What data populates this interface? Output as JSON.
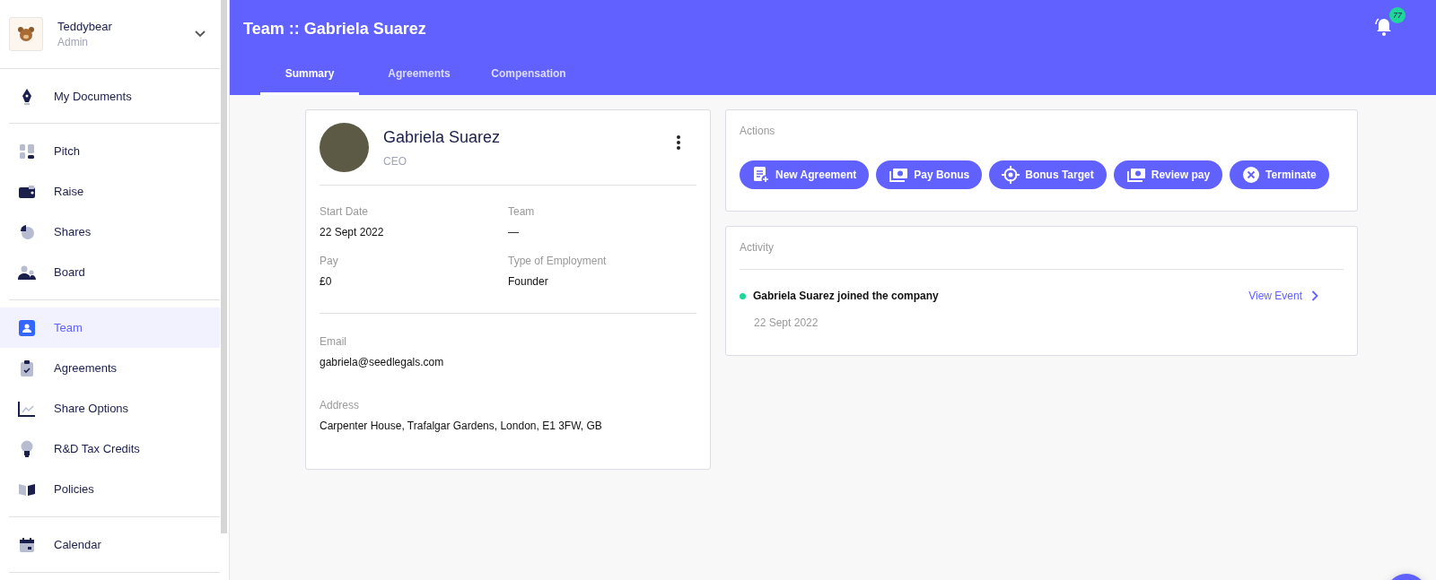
{
  "company": {
    "name": "Teddybear",
    "role": "Admin"
  },
  "sidebar": {
    "groups": [
      [
        {
          "label": "My Documents",
          "selected": false
        }
      ],
      [
        {
          "label": "Pitch",
          "selected": false
        },
        {
          "label": "Raise",
          "selected": false
        },
        {
          "label": "Shares",
          "selected": false
        },
        {
          "label": "Board",
          "selected": false
        }
      ],
      [
        {
          "label": "Team",
          "selected": true
        },
        {
          "label": "Agreements",
          "selected": false
        },
        {
          "label": "Share Options",
          "selected": false
        },
        {
          "label": "R&D Tax Credits",
          "selected": false
        },
        {
          "label": "Policies",
          "selected": false
        }
      ],
      [
        {
          "label": "Calendar",
          "selected": false
        }
      ]
    ]
  },
  "header": {
    "title": "Team :: Gabriela Suarez",
    "notifications": "77"
  },
  "tabs": [
    {
      "label": "Summary",
      "selected": true
    },
    {
      "label": "Agreements",
      "selected": false
    },
    {
      "label": "Compensation",
      "selected": false
    }
  ],
  "profile": {
    "name": "Gabriela Suarez",
    "role": "CEO",
    "fields": [
      {
        "label": "Start Date",
        "value": "22 Sept 2022"
      },
      {
        "label": "Team",
        "value": "—"
      },
      {
        "label": "Pay",
        "value": "£0"
      },
      {
        "label": "Type of Employment",
        "value": "Founder"
      }
    ],
    "contact": [
      {
        "label": "Email",
        "value": "gabriela@seedlegals.com"
      },
      {
        "label": "Address",
        "value": "Carpenter House, Trafalgar Gardens, London, E1 3FW, GB"
      }
    ]
  },
  "actions": {
    "title": "Actions",
    "buttons": [
      {
        "label": "New Agreement",
        "kind": "document"
      },
      {
        "label": "Pay Bonus",
        "kind": "money"
      },
      {
        "label": "Bonus Target",
        "kind": "target"
      },
      {
        "label": "Review pay",
        "kind": "money"
      },
      {
        "label": "Terminate",
        "kind": "cancel"
      }
    ]
  },
  "activity": {
    "title": "Activity",
    "events": [
      {
        "text": "Gabriela Suarez joined the company",
        "date": "22 Sept 2022",
        "link": "View Event",
        "color": "#1ed69a"
      }
    ]
  }
}
